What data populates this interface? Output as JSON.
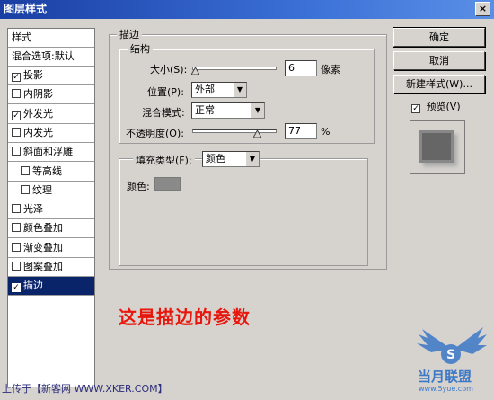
{
  "window": {
    "title": "图层样式",
    "close_symbol": "×"
  },
  "style_list": {
    "header": "样式",
    "blend_options": "混合选项:默认",
    "items": [
      {
        "label": "投影",
        "checked": true
      },
      {
        "label": "内阴影",
        "checked": false
      },
      {
        "label": "外发光",
        "checked": true
      },
      {
        "label": "内发光",
        "checked": false
      },
      {
        "label": "斜面和浮雕",
        "checked": false
      },
      {
        "label": "等高线",
        "checked": false
      },
      {
        "label": "纹理",
        "checked": false
      },
      {
        "label": "光泽",
        "checked": false
      },
      {
        "label": "颜色叠加",
        "checked": false
      },
      {
        "label": "渐变叠加",
        "checked": false
      },
      {
        "label": "图案叠加",
        "checked": false
      },
      {
        "label": "描边",
        "checked": true
      }
    ]
  },
  "stroke_panel": {
    "title": "描边",
    "structure_title": "结构",
    "size_label": "大小(S):",
    "size_value": "6",
    "size_unit": "像素",
    "size_fraction": 0.03,
    "position_label": "位置(P):",
    "position_value": "外部",
    "blend_mode_label": "混合模式:",
    "blend_mode_value": "正常",
    "opacity_label": "不透明度(O):",
    "opacity_value": "77",
    "opacity_unit": "%",
    "opacity_fraction": 0.77,
    "fill_type_label": "填充类型(F):",
    "fill_type_value": "颜色",
    "color_label": "颜色:",
    "color_swatch": "#8a8a8a"
  },
  "buttons": {
    "ok": "确定",
    "cancel": "取消",
    "new_style": "新建样式(W)...",
    "preview_label": "预览(V)",
    "preview_checked": true
  },
  "overlay": {
    "caption": "这是描边的参数",
    "footer": "上传于【新客网 WWW.XKER.COM】",
    "watermark": "当月联盟",
    "watermark_url": "www.5yue.com"
  },
  "colors": {
    "title_bar": "#1a3fa3",
    "selected_row": "#0a246a",
    "caption_red": "#e8160c",
    "watermark_blue": "#3c78c8"
  }
}
